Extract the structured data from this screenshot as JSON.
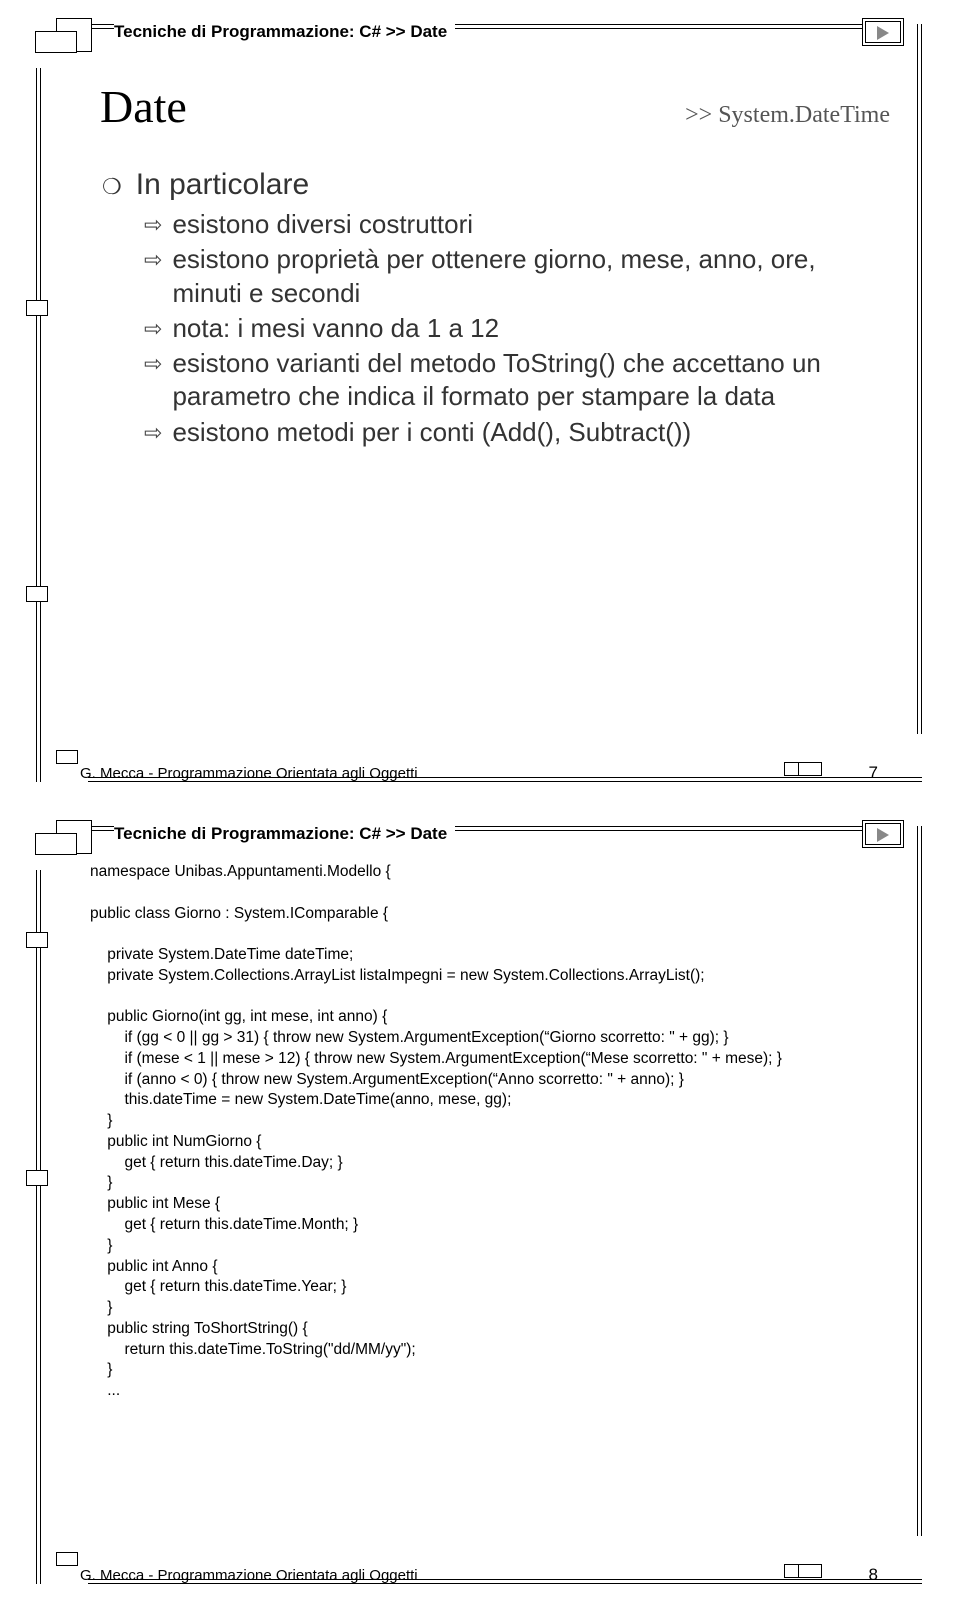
{
  "breadcrumb": "Tecniche di Programmazione: C# >> Date",
  "slide1": {
    "title": "Date",
    "subtitle": ">> System.DateTime",
    "lvl1": "In particolare",
    "pts": [
      "esistono diversi costruttori",
      "esistono proprietà per ottenere giorno, mese, anno, ore, minuti e secondi",
      "nota: i mesi vanno da 1 a 12",
      "esistono varianti del metodo ToString() che accettano un parametro che indica il formato per stampare la data",
      "esistono metodi per i conti (Add(), Subtract())"
    ],
    "page": "7"
  },
  "slide2": {
    "code": "namespace Unibas.Appuntamenti.Modello {\n\npublic class Giorno : System.IComparable {\n\n    private System.DateTime dateTime;\n    private System.Collections.ArrayList listaImpegni = new System.Collections.ArrayList();\n\n    public Giorno(int gg, int mese, int anno) {\n        if (gg < 0 || gg > 31) { throw new System.ArgumentException(“Giorno scorretto: \" + gg); }\n        if (mese < 1 || mese > 12) { throw new System.ArgumentException(“Mese scorretto: \" + mese); }\n        if (anno < 0) { throw new System.ArgumentException(“Anno scorretto: \" + anno); }\n        this.dateTime = new System.DateTime(anno, mese, gg);\n    }\n    public int NumGiorno {\n        get { return this.dateTime.Day; }\n    }\n    public int Mese {\n        get { return this.dateTime.Month; }\n    }\n    public int Anno {\n        get { return this.dateTime.Year; }\n    }\n    public string ToShortString() {\n        return this.dateTime.ToString(\"dd/MM/yy\");\n    }\n    ...",
    "page": "8"
  },
  "footer": "G. Mecca - Programmazione Orientata agli Oggetti"
}
